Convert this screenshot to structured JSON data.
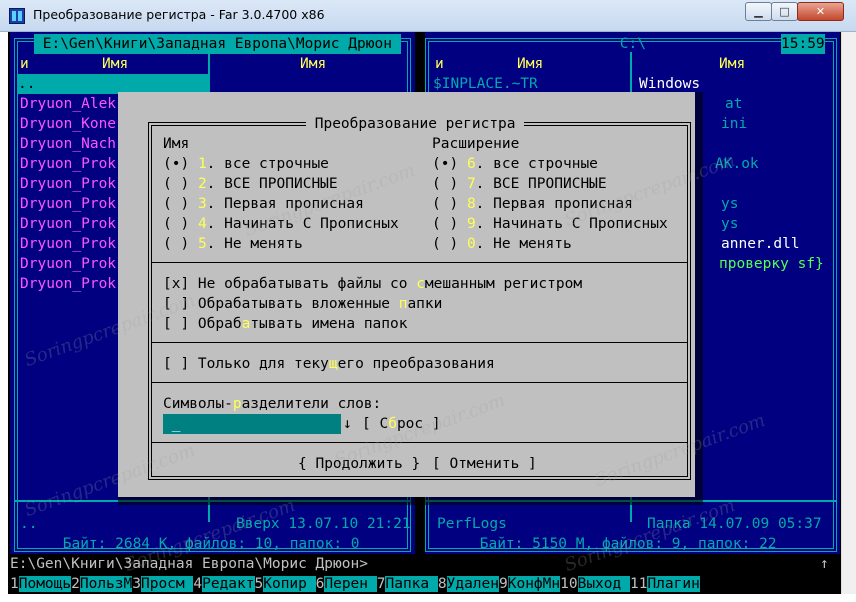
{
  "window": {
    "title": "Преобразование регистра - Far 3.0.4700 x86",
    "min_glyph": "▁",
    "max_glyph": "□",
    "close_glyph": "✕"
  },
  "left_panel": {
    "path": " E:\\Gen\\Книги\\Западная Европа\\Морис Дрюон ",
    "col_n": "и",
    "col1": "Имя",
    "col2": "Имя",
    "updir": "..",
    "files": [
      "Dryuon_Alek",
      "Dryuon_Kone",
      "Dryuon_Nach",
      "Dryuon_Prok",
      "Dryuon_Prok",
      "Dryuon_Prok",
      "Dryuon_Prok",
      "Dryuon_Prok",
      "Dryuon_Prok",
      "Dryuon_Prok"
    ],
    "footer_name": "..",
    "footer_info": "Вверх 13.07.10 21:21",
    "summary": " Байт: 2684 K, файлов: 10, папок: 0 "
  },
  "right_panel": {
    "path": " C:\\ ",
    "clock": "15:59",
    "col_n": "и",
    "col1": "Имя",
    "col2": "Имя",
    "row1_col1": "$INPLACE.~TR",
    "row1_col2": "Windows",
    "partial": [
      "at",
      "ini",
      "",
      "AK.ok",
      "",
      "ys",
      "ys",
      "anner.dll",
      "проверку sf}"
    ],
    "footer_name": "PerfLogs",
    "footer_info": "Папка 14.07.09 05:37",
    "summary": " Байт: 5150 M, файлов: 9, папок: 22 "
  },
  "dialog": {
    "title": " Преобразование регистра ",
    "name_label": "Имя",
    "ext_label": "Расширение",
    "name_options": [
      {
        "mark": "(•)",
        "key": "1",
        "text": "все строчные"
      },
      {
        "mark": "( )",
        "key": "2",
        "text": "ВСЕ ПРОПИСНЫЕ"
      },
      {
        "mark": "( )",
        "key": "3",
        "text": "Первая прописная"
      },
      {
        "mark": "( )",
        "key": "4",
        "text": "Начинать С Прописных"
      },
      {
        "mark": "( )",
        "key": "5",
        "text": "Не менять"
      }
    ],
    "ext_options": [
      {
        "mark": "(•)",
        "key": "6",
        "text": "все строчные"
      },
      {
        "mark": "( )",
        "key": "7",
        "text": "ВСЕ ПРОПИСНЫЕ"
      },
      {
        "mark": "( )",
        "key": "8",
        "text": "Первая прописная"
      },
      {
        "mark": "( )",
        "key": "9",
        "text": "Начинать С Прописных"
      },
      {
        "mark": "( )",
        "key": "0",
        "text": "Не менять"
      }
    ],
    "chk1": {
      "mark": "[x]",
      "pre": " Не обрабатывать файлы со ",
      "hot": "с",
      "post": "мешанным регистром"
    },
    "chk2": {
      "mark": "[ ]",
      "pre": " Обрабатывать вложенные ",
      "hot": "п",
      "post": "апки"
    },
    "chk3": {
      "mark": "[ ]",
      "pre": " Обраб",
      "hot": "а",
      "post": "тывать имена папок"
    },
    "chk4": {
      "mark": "[ ]",
      "pre": " Только для теку",
      "hot": "щ",
      "post": "его преобразования"
    },
    "sep_label": {
      "pre": "Символы-",
      "hot": "р",
      "post": "азделители слов:"
    },
    "sep_value": " _",
    "history_arrow": "↓",
    "reset": {
      "pre": "[ С",
      "hot": "б",
      "post": "рос ]"
    },
    "continue_btn": "{ Продолжить }",
    "cancel_btn": "[ Отменить ]"
  },
  "cmdline": {
    "prompt": "E:\\Gen\\Книги\\Западная Европа\\Морис Дрюон>",
    "scroll_glyph": "↑"
  },
  "fkeys": [
    {
      "n": "1",
      "label": "Помощь"
    },
    {
      "n": "2",
      "label": "ПользМ"
    },
    {
      "n": "3",
      "label": "Просм "
    },
    {
      "n": "4",
      "label": "Редакт"
    },
    {
      "n": "5",
      "label": "Копир "
    },
    {
      "n": "6",
      "label": "Перен "
    },
    {
      "n": "7",
      "label": "Папка "
    },
    {
      "n": "8",
      "label": "Удален"
    },
    {
      "n": "9",
      "label": "КонфМн"
    },
    {
      "n": "10",
      "label": "Выход "
    },
    {
      "n": "11",
      "label": "Плагин"
    }
  ],
  "watermarks": [
    "Soringpcrepair.com"
  ],
  "colors": {
    "panel_bg": "#000080",
    "frame": "#00aaaa",
    "file_magenta": "#ff55ff",
    "dialog_bg": "#c0c0c0",
    "hotkey": "#ffff55"
  }
}
